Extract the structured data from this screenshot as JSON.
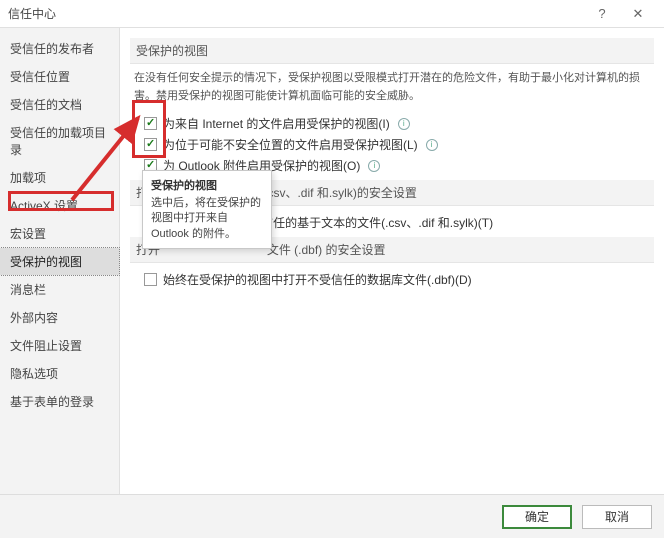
{
  "window": {
    "title": "信任中心"
  },
  "sidebar": {
    "items": [
      {
        "label": "受信任的发布者"
      },
      {
        "label": "受信任位置"
      },
      {
        "label": "受信任的文档"
      },
      {
        "label": "受信任的加载项目录"
      },
      {
        "label": "加载项"
      },
      {
        "label": "ActiveX 设置"
      },
      {
        "label": "宏设置"
      },
      {
        "label": "受保护的视图"
      },
      {
        "label": "消息栏"
      },
      {
        "label": "外部内容"
      },
      {
        "label": "文件阻止设置"
      },
      {
        "label": "隐私选项"
      },
      {
        "label": "基于表单的登录"
      }
    ],
    "selected_index": 7
  },
  "content": {
    "heading1": "受保护的视图",
    "intro": "在没有任何安全提示的情况下，受保护视图以受限模式打开潜在的危险文件，有助于最小化对计算机的损害。禁用受保护的视图可能使计算机面临可能的安全威胁。",
    "checks1": [
      {
        "label": "为来自 Internet 的文件启用受保护的视图(I)",
        "checked": true,
        "info": true
      },
      {
        "label": "为位于可能不安全位置的文件启用受保护视图(L)",
        "checked": true,
        "info": true
      },
      {
        "label": "为 Outlook 附件启用受保护的视图(O)",
        "checked": true,
        "info": true
      }
    ],
    "heading2_prefix": "打开",
    "heading2_suffix": "的安全设置",
    "heading2_filetypes": "(.csv、.dif 和.sylk)",
    "checks2": [
      {
        "label": "受信任的基于文本的文件(.csv、.dif 和.sylk)(T)",
        "checked": false
      }
    ],
    "heading3_trunc": "文件 (.dbf) 的安全设置",
    "checks3": [
      {
        "label": "始终在受保护的视图中打开不受信任的数据库文件(.dbf)(D)",
        "checked": false
      }
    ]
  },
  "tooltip": {
    "title": "受保护的视图",
    "body": "选中后，将在受保护的视图中打开来自 Outlook 的附件。"
  },
  "footer": {
    "ok": "确定",
    "cancel": "取消"
  }
}
